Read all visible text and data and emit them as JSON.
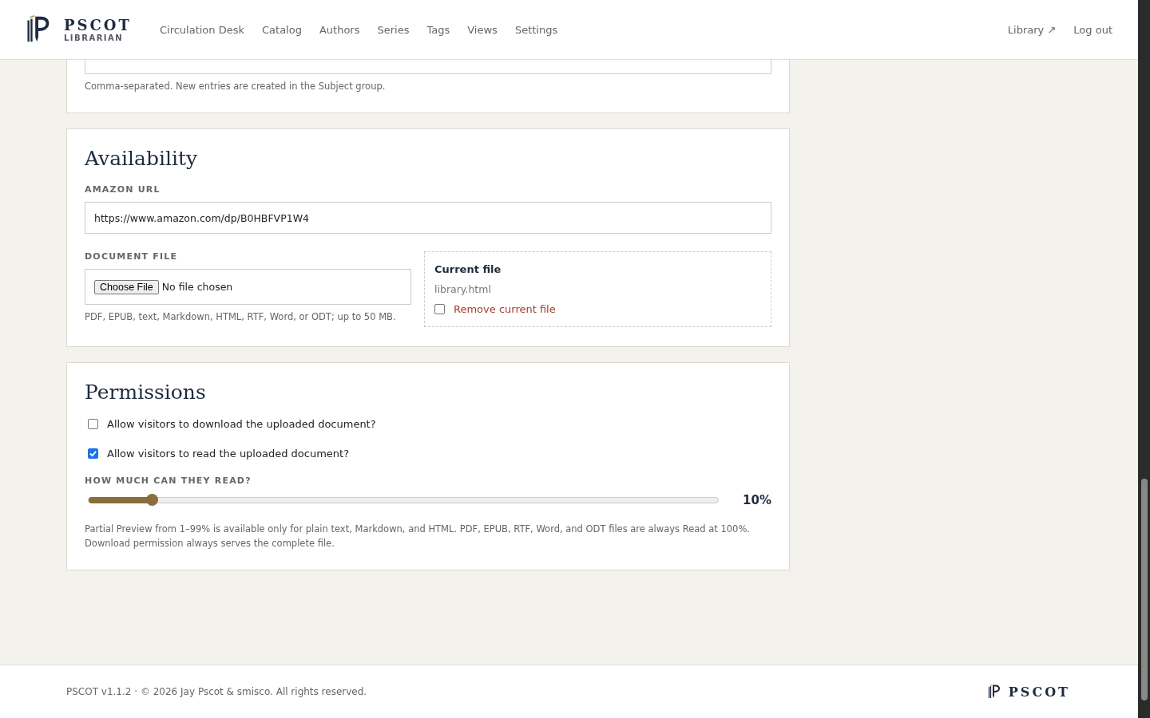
{
  "header": {
    "brand": "PSCOT",
    "subtitle": "LIBRARIAN",
    "nav": [
      {
        "label": "Circulation Desk",
        "selected": false
      },
      {
        "label": "Catalog",
        "selected": false
      },
      {
        "label": "Authors",
        "selected": false
      },
      {
        "label": "Series",
        "selected": false
      },
      {
        "label": "Tags",
        "selected": false
      },
      {
        "label": "Views",
        "selected": false
      },
      {
        "label": "Settings",
        "selected": false
      }
    ],
    "library_link": "Library ↗",
    "logout": "Log out"
  },
  "subjects": {
    "hint": "Comma-separated. New entries are created in the Subject group."
  },
  "availability": {
    "title": "Availability",
    "amazon_label": "AMAZON URL",
    "amazon_url": "https://www.amazon.com/dp/B0HBFVP1W4",
    "document_label": "DOCUMENT FILE",
    "choose_button": "Choose File",
    "no_file": "No file chosen",
    "document_hint": "PDF, EPUB, text, Markdown, HTML, RTF, Word, or ODT; up to 50 MB.",
    "current_title": "Current file",
    "current_name": "library.html",
    "remove": {
      "label": "Remove current file",
      "checked": false
    }
  },
  "permissions": {
    "title": "Permissions",
    "options": [
      {
        "label": "Allow visitors to download the uploaded document?",
        "checked": false
      },
      {
        "label": "Allow visitors to read the uploaded document?",
        "checked": true
      }
    ],
    "read_label": "HOW MUCH CAN THEY READ?",
    "read": {
      "level": 0.1,
      "reading": "10%"
    },
    "hint": "Partial Preview from 1–99% is available only for plain text, Markdown, and HTML. PDF, EPUB, RTF, Word, and ODT files are always Read at 100%. Download permission always serves the complete file."
  },
  "footer": {
    "copyright": "PSCOT v1.1.2 · © 2026 Jay Pscot & smisco. All rights reserved.",
    "brand": "PSCOT"
  }
}
